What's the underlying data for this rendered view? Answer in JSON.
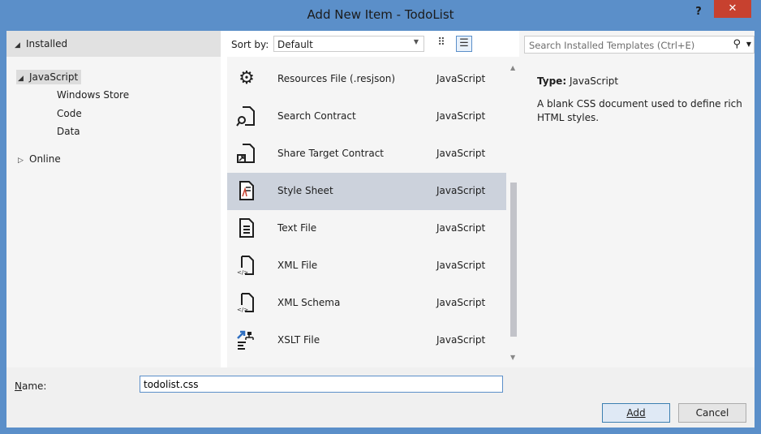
{
  "window": {
    "title": "Add New Item - TodoList",
    "help": "?",
    "close": "✕"
  },
  "sidebar": {
    "header": "Installed",
    "tree": [
      {
        "label": "JavaScript",
        "arrow": "◢"
      },
      {
        "label": "Windows Store"
      },
      {
        "label": "Code"
      },
      {
        "label": "Data"
      },
      {
        "label": "Online",
        "arrow": "▷"
      }
    ]
  },
  "sort": {
    "label": "Sort by:",
    "value": "Default"
  },
  "items": [
    {
      "name": "Resources File (.resjson)",
      "type": "JavaScript",
      "icon": "gear-icon"
    },
    {
      "name": "Search Contract",
      "type": "JavaScript",
      "icon": "search-contract-icon"
    },
    {
      "name": "Share Target Contract",
      "type": "JavaScript",
      "icon": "share-target-icon"
    },
    {
      "name": "Style Sheet",
      "type": "JavaScript",
      "icon": "style-sheet-icon"
    },
    {
      "name": "Text File",
      "type": "JavaScript",
      "icon": "text-file-icon"
    },
    {
      "name": "XML File",
      "type": "JavaScript",
      "icon": "xml-file-icon"
    },
    {
      "name": "XML Schema",
      "type": "JavaScript",
      "icon": "xml-schema-icon"
    },
    {
      "name": "XSLT File",
      "type": "JavaScript",
      "icon": "xslt-file-icon"
    }
  ],
  "search": {
    "placeholder": "Search Installed Templates (Ctrl+E)"
  },
  "details": {
    "type_label": "Type:",
    "type_value": "JavaScript",
    "description": "A blank CSS document used to define rich HTML styles."
  },
  "name_field": {
    "label": "Name:",
    "value": "todolist.css"
  },
  "buttons": {
    "add": "Add",
    "cancel": "Cancel"
  },
  "colors": {
    "accent": "#5b8fc9",
    "close": "#c7412f",
    "selected": "#ccd2dc"
  }
}
